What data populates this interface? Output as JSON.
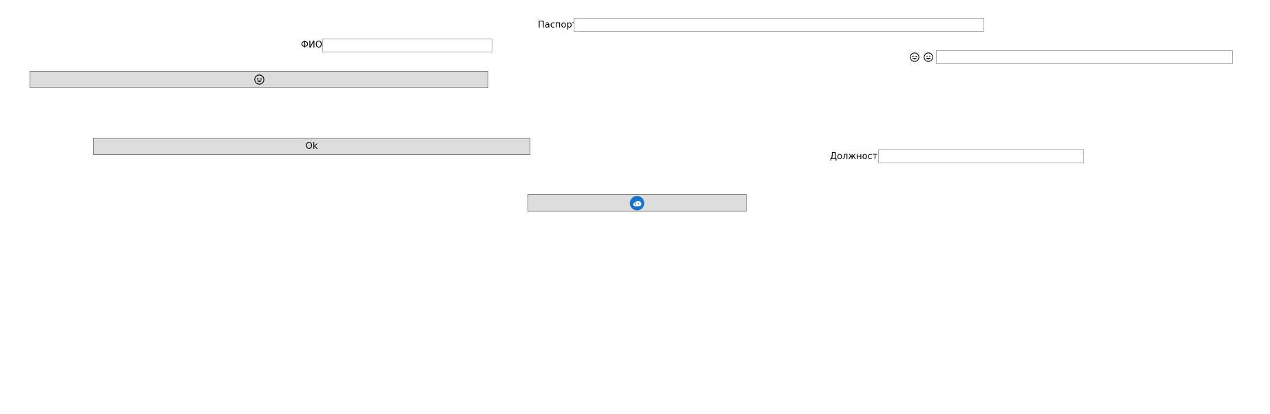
{
  "form": {
    "passport": {
      "label": "Паспорт",
      "value": "",
      "placeholder": ""
    },
    "fio": {
      "label": "ФИО",
      "value": "",
      "placeholder": ""
    },
    "emoji_field": {
      "value": "",
      "placeholder": ""
    },
    "position": {
      "label": "Должность",
      "value": "",
      "placeholder": ""
    }
  },
  "buttons": {
    "emoji_button": {
      "icon": "grinning-face-icon"
    },
    "ok_button": {
      "label": "Ok"
    },
    "logo_button": {
      "icon": "blue-circle-logo-icon",
      "color": "#1a73c8"
    }
  },
  "icons": {
    "emoji_label_left": "grinning-squint-face-icon",
    "emoji_label_right": "smiling-face-icon"
  },
  "colors": {
    "button_bg": "#dddddd",
    "button_border": "#7a7a7a",
    "input_border": "#a9a9a9",
    "logo_blue": "#1a73c8"
  }
}
